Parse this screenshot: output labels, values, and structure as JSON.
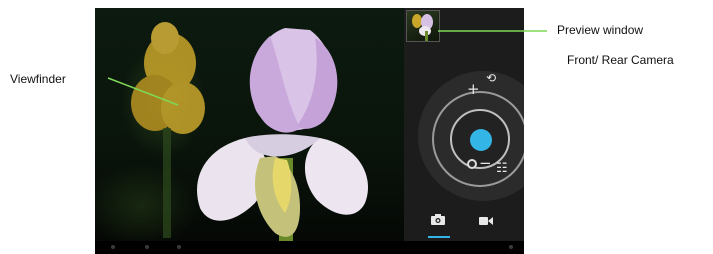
{
  "annotations": {
    "viewfinder": "Viewfinder",
    "preview_window": "Preview window",
    "camera_switch": "Front/ Rear Camera"
  },
  "camera": {
    "modes": [
      {
        "name": "photo",
        "icon": "camera-icon",
        "active": true
      },
      {
        "name": "video",
        "icon": "video-camera-icon",
        "active": false
      }
    ],
    "controls": {
      "zoom_in_icon": "plus-icon",
      "zoom_out_icon": "minus-icon",
      "switch_icon": "front-rear-switch-icon",
      "settings_icon": "sliders-icon",
      "shutter_icon": "shutter-button"
    }
  },
  "colors": {
    "accent": "#33b5e5",
    "panel": "#1c1c1c",
    "dial": "#2b2b2b",
    "callout_line": "#7ed957"
  }
}
